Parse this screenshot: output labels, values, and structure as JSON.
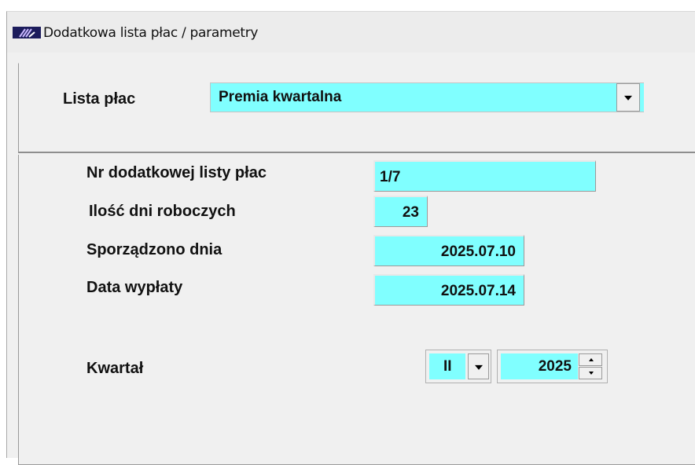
{
  "window": {
    "title": "Dodatkowa lista płac / parametry",
    "icon": "app-logo-icon"
  },
  "payroll": {
    "label": "Lista płac",
    "selected": "Premia kwartalna"
  },
  "fields": {
    "number_label": "Nr dodatkowej listy płac",
    "number_value": "1/7",
    "workdays_label": "Ilość dni roboczych",
    "workdays_value": "23",
    "prepared_label": "Sporządzono dnia",
    "prepared_value": "2025.07.10",
    "payout_label": "Data wypłaty",
    "payout_value": "2025.07.14"
  },
  "quarter": {
    "label": "Kwartał",
    "quarter_value": "II",
    "year_value": "2025"
  },
  "colors": {
    "field_background": "#80ffff",
    "window_background": "#f0f0f0",
    "icon_background": "#1c1c5c"
  }
}
